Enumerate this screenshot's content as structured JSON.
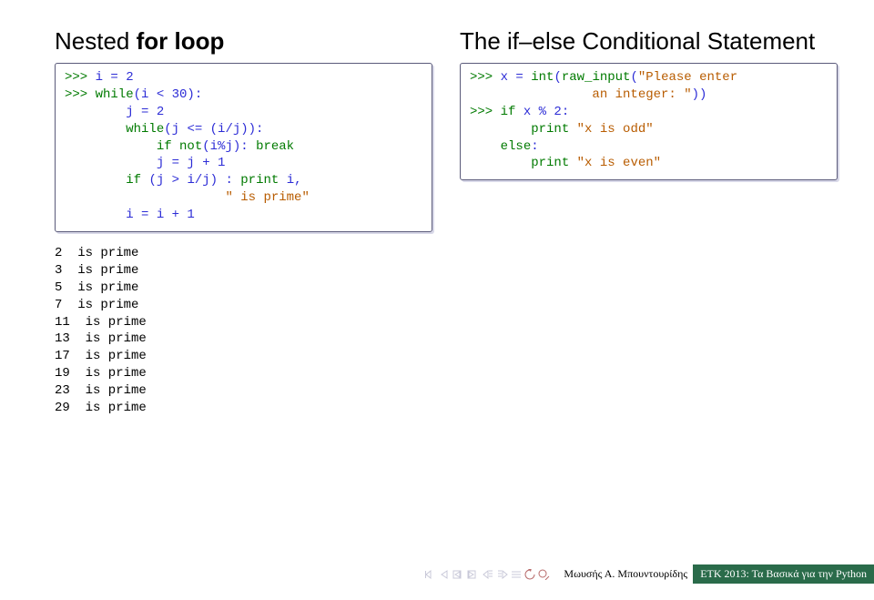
{
  "left": {
    "heading_plain": "Nested ",
    "heading_bold": "for loop",
    "code_lines": [
      [
        [
          "k",
          ">>> "
        ],
        [
          "b",
          "i = 2"
        ]
      ],
      [
        [
          "k",
          ">>> while"
        ],
        [
          "b",
          "(i < 30):"
        ]
      ],
      [
        [
          "b",
          "        j = 2"
        ]
      ],
      [
        [
          "b",
          "        "
        ],
        [
          "k",
          "while"
        ],
        [
          "b",
          "(j <= (i/j)):"
        ]
      ],
      [
        [
          "b",
          "            "
        ],
        [
          "k",
          "if not"
        ],
        [
          "b",
          "(i%j): "
        ],
        [
          "k",
          "break"
        ]
      ],
      [
        [
          "b",
          "            j = j + 1"
        ]
      ],
      [
        [
          "b",
          "        "
        ],
        [
          "k",
          "if "
        ],
        [
          "b",
          "(j > i/j) : "
        ],
        [
          "k",
          "print "
        ],
        [
          "b",
          "i,"
        ]
      ],
      [
        [
          "b",
          "                     "
        ],
        [
          "s",
          "\" is prime\""
        ]
      ],
      [
        [
          "b",
          "        i = i + 1"
        ]
      ]
    ],
    "output": "2  is prime\n3  is prime\n5  is prime\n7  is prime\n11  is prime\n13  is prime\n17  is prime\n19  is prime\n23  is prime\n29  is prime"
  },
  "right": {
    "heading_pre": "The if",
    "heading_mid": "else Conditional Statement",
    "code_lines": [
      [
        [
          "k",
          ">>> "
        ],
        [
          "b",
          "x = "
        ],
        [
          "k",
          "int"
        ],
        [
          "b",
          "("
        ],
        [
          "k",
          "raw_input"
        ],
        [
          "b",
          "("
        ],
        [
          "s",
          "\"Please enter"
        ]
      ],
      [
        [
          "s",
          "                an integer: \""
        ],
        [
          "b",
          "))"
        ]
      ],
      [
        [
          "k",
          ">>> if "
        ],
        [
          "b",
          "x % 2:"
        ]
      ],
      [
        [
          "b",
          "        "
        ],
        [
          "k",
          "print "
        ],
        [
          "s",
          "\"x is odd\""
        ]
      ],
      [
        [
          "b",
          "    "
        ],
        [
          "k",
          "else"
        ],
        [
          "b",
          ":"
        ]
      ],
      [
        [
          "b",
          "        "
        ],
        [
          "k",
          "print "
        ],
        [
          "s",
          "\"x is even\""
        ]
      ]
    ]
  },
  "footer": {
    "left": "Μωυσής Α. Μπουντουρίδης",
    "right": "ΕΤΚ 2013: Τα Βασικά για την Python"
  }
}
